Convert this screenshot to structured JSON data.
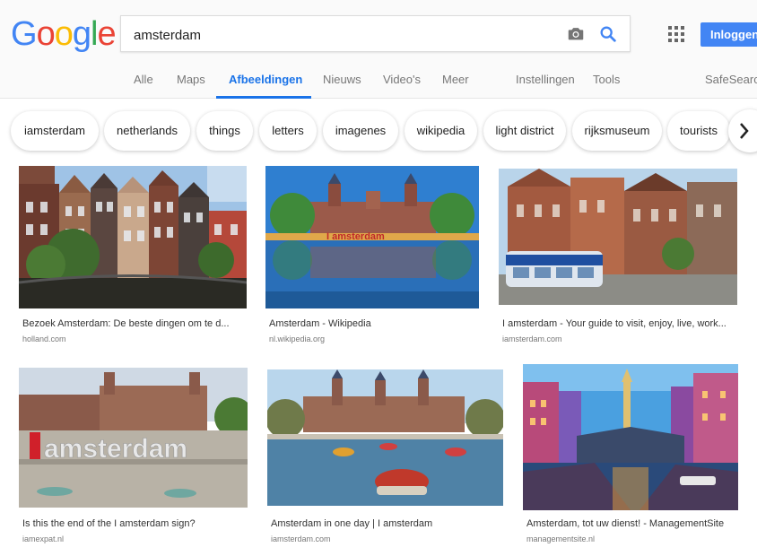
{
  "search": {
    "query": "amsterdam"
  },
  "header": {
    "login_label": "Inloggen",
    "logo": [
      "G",
      "o",
      "o",
      "g",
      "l",
      "e"
    ],
    "logo_colors": [
      "#4285f4",
      "#ea4335",
      "#fbbc05",
      "#4285f4",
      "#34a853",
      "#ea4335"
    ]
  },
  "nav": {
    "items": [
      "Alle",
      "Maps",
      "Afbeeldingen",
      "Nieuws",
      "Video's",
      "Meer"
    ],
    "settings": "Instellingen",
    "tools": "Tools",
    "safesearch": "SafeSearch",
    "active_index": 2
  },
  "chips": [
    "iamsterdam",
    "netherlands",
    "things",
    "letters",
    "imagenes",
    "wikipedia",
    "light district",
    "rijksmuseum",
    "tourists"
  ],
  "results": [
    {
      "caption": "Bezoek Amsterdam: De beste dingen om te d...",
      "source": "holland.com"
    },
    {
      "caption": "Amsterdam - Wikipedia",
      "source": "nl.wikipedia.org"
    },
    {
      "caption": "I amsterdam - Your guide to visit, enjoy, live, work...",
      "source": "iamsterdam.com"
    },
    {
      "caption": "Is this the end of the I amsterdam sign?",
      "source": "iamexpat.nl"
    },
    {
      "caption": "Amsterdam in one day | I amsterdam",
      "source": "iamsterdam.com"
    },
    {
      "caption": "Amsterdam, tot uw dienst! - ManagementSite",
      "source": "managementsite.nl"
    }
  ],
  "colors": {
    "accent": "#1a73e8",
    "login_bg": "#4285f4"
  }
}
